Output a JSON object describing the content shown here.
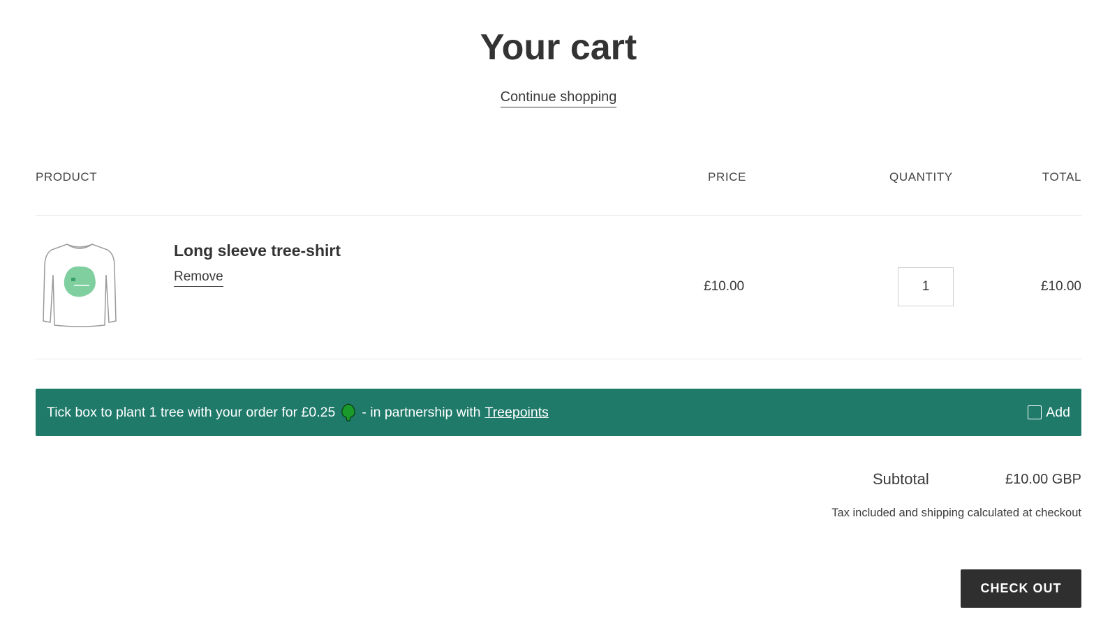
{
  "page": {
    "title": "Your cart",
    "continue_label": "Continue shopping"
  },
  "table": {
    "headers": {
      "product": "PRODUCT",
      "price": "PRICE",
      "quantity": "QUANTITY",
      "total": "TOTAL"
    },
    "items": [
      {
        "name": "Long sleeve tree-shirt",
        "remove_label": "Remove",
        "price": "£10.00",
        "quantity": "1",
        "total": "£10.00",
        "image_icon": "long-sleeve-shirt-icon"
      }
    ]
  },
  "tree_offer": {
    "text_before": "Tick box to plant 1 tree with your order for £0.25",
    "icon": "tree-icon",
    "text_after": "- in partnership with",
    "link_label": "Treepoints",
    "add_label": "Add",
    "checked": false,
    "color": "#1f7a6a"
  },
  "summary": {
    "subtotal_label": "Subtotal",
    "subtotal_value": "£10.00 GBP",
    "tax_note": "Tax included and shipping calculated at checkout",
    "checkout_label": "CHECK OUT"
  }
}
